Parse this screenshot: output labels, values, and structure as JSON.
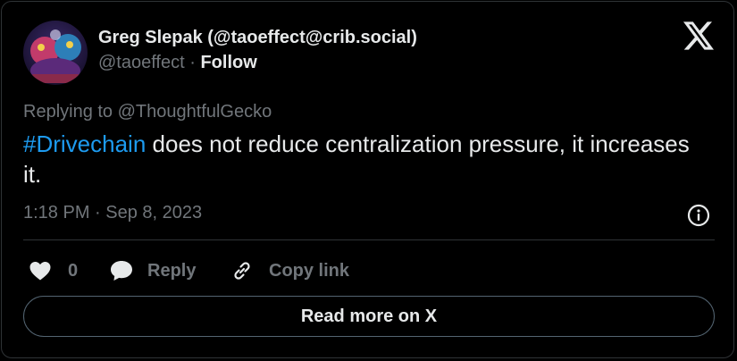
{
  "author": {
    "display_name": "Greg Slepak (@taoeffect@crib.social)",
    "handle": "@taoeffect",
    "separator": " · ",
    "follow_label": "Follow"
  },
  "tweet": {
    "replying_to": "Replying to @ThoughtfulGecko",
    "hashtag": "#Drivechain",
    "text_rest": " does not reduce centralization pressure, it increases it.",
    "timestamp": "1:18 PM · Sep 8, 2023"
  },
  "actions": {
    "like_count": "0",
    "reply_label": "Reply",
    "copy_link_label": "Copy link"
  },
  "read_more_label": "Read more on X",
  "icons": {
    "brand": "x-logo-icon",
    "info": "info-icon",
    "like": "heart-icon",
    "reply": "speech-bubble-icon",
    "copy": "link-icon"
  },
  "colors": {
    "background": "#000000",
    "text": "#e7e9ea",
    "muted": "#71767b",
    "link": "#1d9bf0",
    "border": "#2f3336"
  }
}
